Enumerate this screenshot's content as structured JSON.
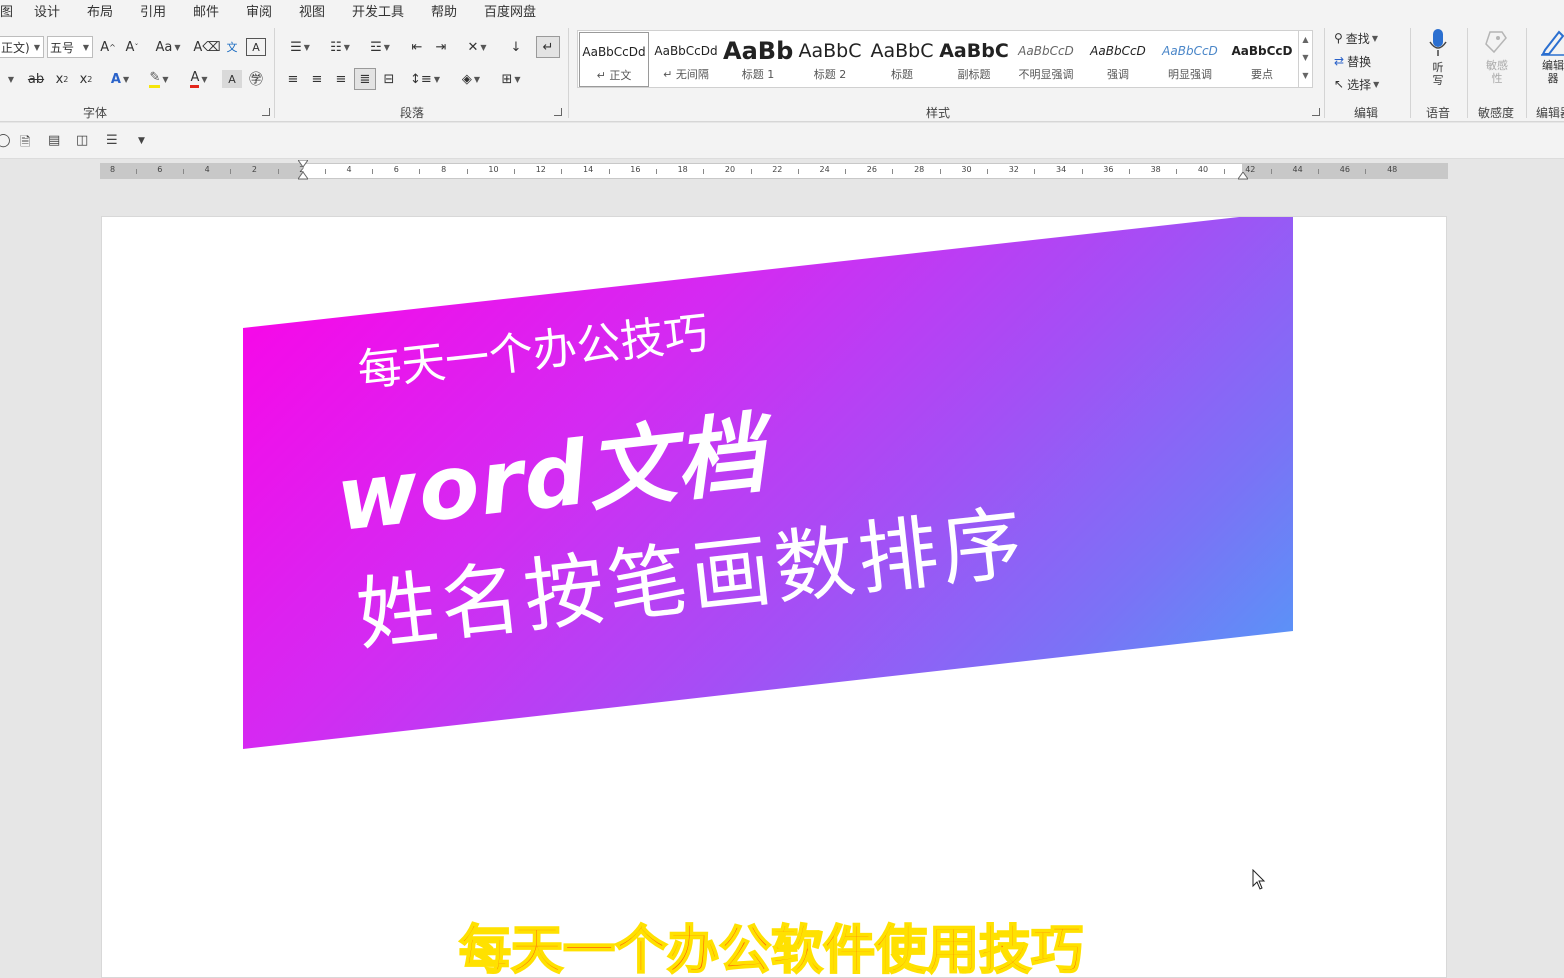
{
  "menu": {
    "tabs": [
      "图",
      "设计",
      "布局",
      "引用",
      "邮件",
      "审阅",
      "视图",
      "开发工具",
      "帮助",
      "百度网盘"
    ]
  },
  "font_group": {
    "font_name": "正文)",
    "font_size": "五号",
    "label": "字体"
  },
  "paragraph_group": {
    "label": "段落"
  },
  "styles_group": {
    "label": "样式",
    "items": [
      {
        "sample": "AaBbCcDd",
        "name": "↵ 正文"
      },
      {
        "sample": "AaBbCcDd",
        "name": "↵ 无间隔"
      },
      {
        "sample": "AaBb",
        "name": "标题 1"
      },
      {
        "sample": "AaBbC",
        "name": "标题 2"
      },
      {
        "sample": "AaBbC",
        "name": "标题"
      },
      {
        "sample": "AaBbC",
        "name": "副标题"
      },
      {
        "sample": "AaBbCcD",
        "name": "不明显强调"
      },
      {
        "sample": "AaBbCcD",
        "name": "强调"
      },
      {
        "sample": "AaBbCcD",
        "name": "明显强调"
      },
      {
        "sample": "AaBbCcD",
        "name": "要点"
      }
    ]
  },
  "editing_group": {
    "label": "编辑",
    "find": "查找",
    "replace": "替换",
    "select": "选择"
  },
  "voice_group": {
    "label": "语音",
    "dictate": "听写"
  },
  "sensitivity_group": {
    "label": "敏感度",
    "button": "敏感性"
  },
  "editor_group": {
    "label": "编辑器",
    "button": "编辑器"
  },
  "ruler": {
    "numbers": [
      "8",
      "6",
      "4",
      "2",
      "2",
      "4",
      "6",
      "8",
      "10",
      "12",
      "14",
      "16",
      "18",
      "20",
      "22",
      "24",
      "26",
      "28",
      "30",
      "32",
      "34",
      "36",
      "38",
      "40",
      "42",
      "44",
      "46",
      "48"
    ]
  },
  "document": {
    "banner_line1": "每天一个办公技巧",
    "banner_line2": "word文档",
    "banner_line3": "姓名按笔画数排序",
    "caption": "每天一个办公软件使用技巧"
  },
  "colors": {
    "banner_gradient_start": "#ff00e6",
    "banner_gradient_end": "#4aa3f8",
    "caption_fill": "#ff5a0a",
    "caption_stroke": "#ffe100"
  }
}
